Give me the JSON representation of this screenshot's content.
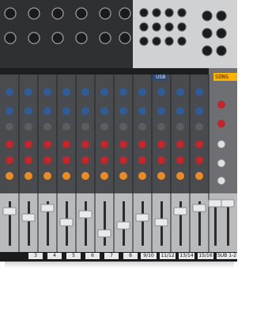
{
  "image": {
    "subject": "",
    "display_text": "SONG",
    "usb_label": "USB",
    "channel_labels": [
      "3",
      "4",
      "5",
      "6",
      "7",
      "8",
      "9/10",
      "11/12",
      "13/14",
      "15/16",
      "SUB 1-2"
    ],
    "colors": {
      "body": "#3a3b3d",
      "panel": "#b8babc",
      "lcd": "#ffb000",
      "knob_blue": "#2f5c96",
      "knob_red": "#c0262b",
      "knob_orange": "#e98c27"
    }
  }
}
